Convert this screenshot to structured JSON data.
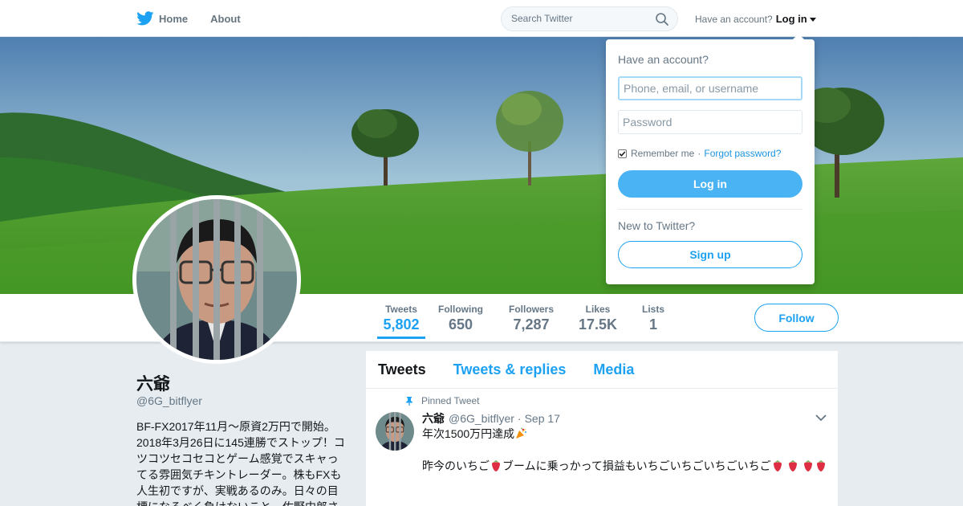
{
  "nav": {
    "home_label": "Home",
    "about_label": "About",
    "search_placeholder": "Search Twitter",
    "account_prompt": "Have an account?",
    "login_label": "Log in"
  },
  "profile": {
    "name": "六爺",
    "handle": "@6G_bitflyer",
    "bio": "BF-FX2017年11月～原資2万円で開始。2018年3月26日に145連勝でストップ！コツコツセコセコとゲーム感覚でスキャってる雰囲気チキントレーダー。株もFXも人生初ですが、実戦あるのみ。日々の目標になるべく負けないこと。佐野中郎さ"
  },
  "stats": [
    {
      "label": "Tweets",
      "value": "5,802",
      "active": true
    },
    {
      "label": "Following",
      "value": "650",
      "active": false
    },
    {
      "label": "Followers",
      "value": "7,287",
      "active": false
    },
    {
      "label": "Likes",
      "value": "17.5K",
      "active": false
    },
    {
      "label": "Lists",
      "value": "1",
      "active": false
    }
  ],
  "follow_label": "Follow",
  "timeline": {
    "tabs": [
      "Tweets",
      "Tweets & replies",
      "Media"
    ],
    "pinned_label": "Pinned Tweet",
    "tweet": {
      "name": "六爺",
      "handle": "@6G_bitflyer",
      "dot": "·",
      "date": "Sep 17",
      "line1": "年次1500万円達成",
      "line2": "昨今のいちご",
      "line2b": "ブームに乗っかって損益もいちごいちごいちごいちご"
    }
  },
  "login_dropdown": {
    "title": "Have an account?",
    "username_placeholder": "Phone, email, or username",
    "password_placeholder": "Password",
    "remember_label": "Remember me",
    "separator": "·",
    "forgot_label": "Forgot password?",
    "login_button": "Log in",
    "new_prompt": "New to Twitter?",
    "signup_button": "Sign up"
  },
  "colors": {
    "accent": "#1da1f2",
    "login_button": "#4ab3f4",
    "muted": "#657786",
    "background": "#e6ecf0"
  }
}
